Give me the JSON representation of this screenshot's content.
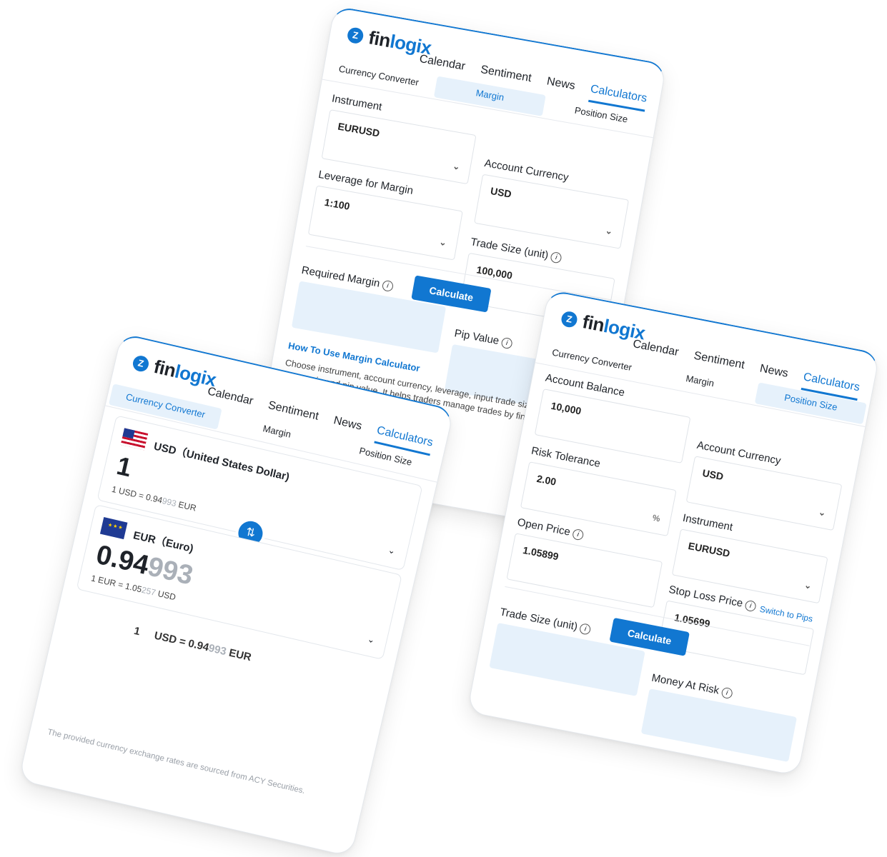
{
  "brand": {
    "fin": "fin",
    "logix": "logix",
    "mark": "Z"
  },
  "nav": [
    "Calendar",
    "Sentiment",
    "News",
    "Calculators"
  ],
  "subtabs": [
    "Currency Converter",
    "Margin",
    "Position Size"
  ],
  "margin_card": {
    "instrument_label": "Instrument",
    "instrument_value": "EURUSD",
    "account_currency_label": "Account Currency",
    "account_currency_value": "USD",
    "leverage_label": "Leverage for Margin",
    "leverage_value": "1:100",
    "trade_size_label": "Trade Size (unit)",
    "trade_size_value": "100,000",
    "calculate": "Calculate",
    "required_margin_label": "Required Margin",
    "pip_value_label": "Pip Value",
    "how_to_link": "How To Use Margin Calculator",
    "description": "Choose instrument, account currency, leverage, input trade size, and for margin and pip value. It helps traders manage trades by finding th calls."
  },
  "position_card": {
    "account_balance_label": "Account Balance",
    "account_balance_value": "10,000",
    "account_currency_label": "Account Currency",
    "account_currency_value": "USD",
    "risk_label": "Risk Tolerance",
    "risk_value": "2.00",
    "risk_suffix": "%",
    "instrument_label": "Instrument",
    "instrument_value": "EURUSD",
    "open_price_label": "Open Price",
    "open_price_value": "1.05899",
    "stop_loss_label": "Stop Loss Price",
    "stop_loss_value": "1.05699",
    "switch_pips": "Switch to Pips",
    "calculate": "Calculate",
    "trade_size_label": "Trade Size (unit)",
    "money_at_risk_label": "Money At Risk"
  },
  "converter_card": {
    "from_code": "USD（United States Dollar)",
    "from_amount": "1",
    "from_rate_pre": "1 USD = 0.94",
    "from_rate_grey": "993",
    "from_rate_post": " EUR",
    "to_code": "EUR（Euro)",
    "to_amount_main": "0.94",
    "to_amount_grey": "993",
    "to_rate_pre": "1 EUR = 1.05",
    "to_rate_grey": "257",
    "to_rate_post": " USD",
    "summary_amount": "1",
    "summary_pre": "USD  =  0.94",
    "summary_grey": "993",
    "summary_post": " EUR",
    "swap_icon": "⇅",
    "footer": "The provided currency exchange rates are sourced from ACY Securities."
  },
  "colors": {
    "accent": "#1177d1",
    "result_bg": "#e6f1fb"
  }
}
